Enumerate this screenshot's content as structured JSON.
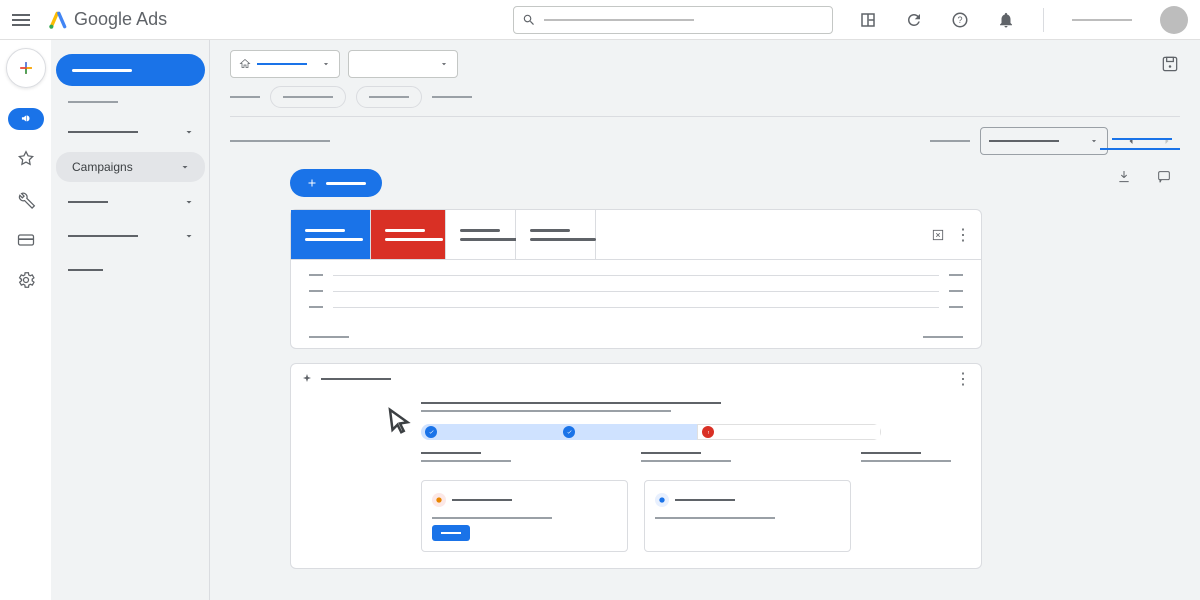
{
  "product": {
    "name_a": "Google",
    "name_b": "Ads"
  },
  "sidenav": {
    "campaigns_label": "Campaigns"
  },
  "colors": {
    "primary": "#1a73e8",
    "danger": "#d93025"
  }
}
